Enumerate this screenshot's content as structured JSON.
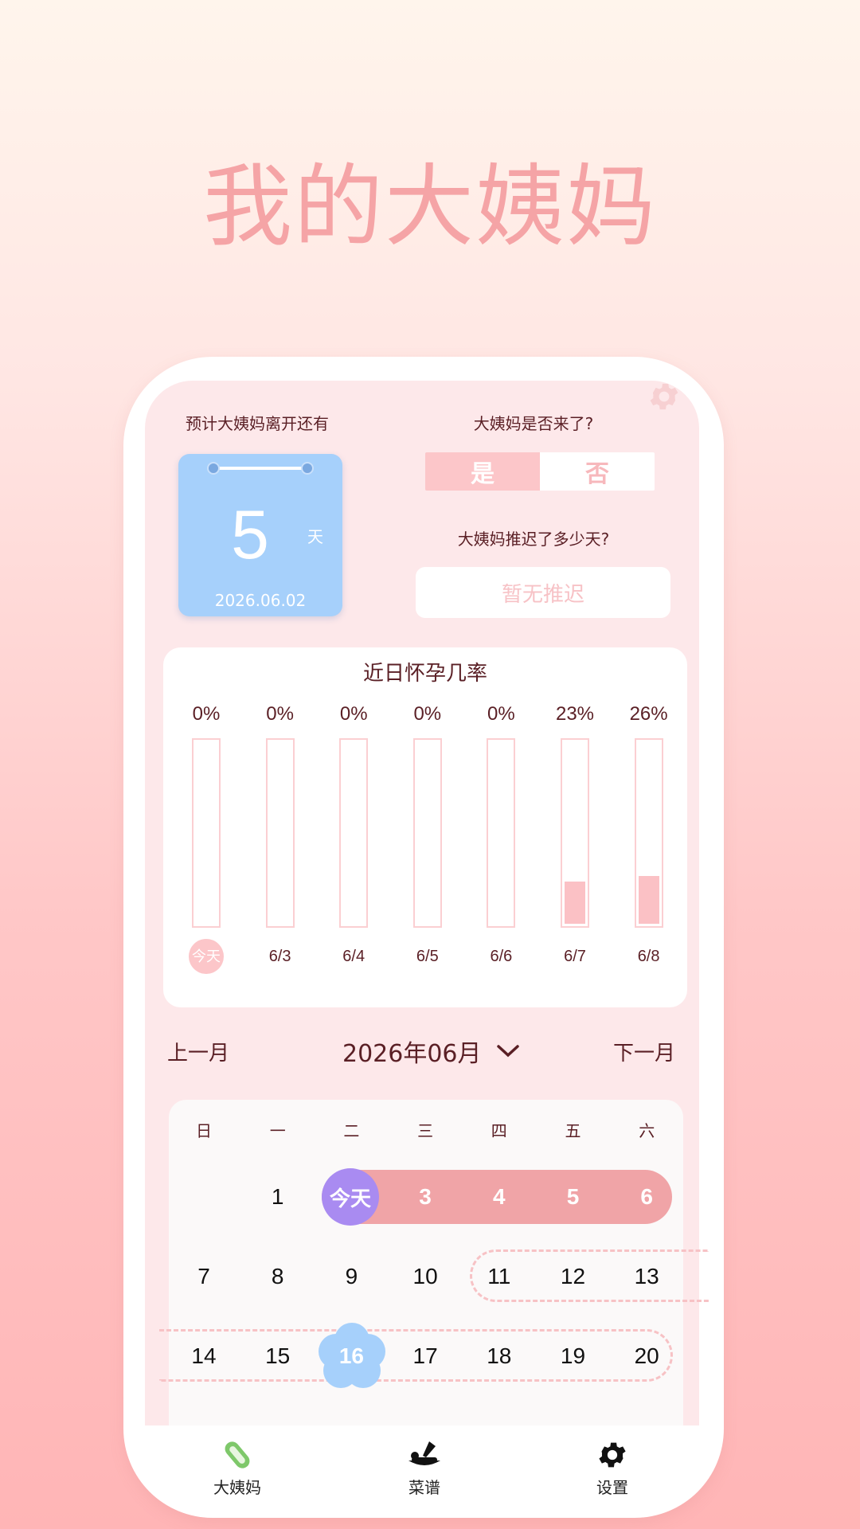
{
  "headline": "我的大姨妈",
  "summary": {
    "left_label": "预计大姨妈离开还有",
    "days_left": "5",
    "days_unit": "天",
    "end_date": "2026.06.02",
    "came_question": "大姨妈是否来了?",
    "came_yes": "是",
    "came_no": "否",
    "came_selected": "是",
    "delay_question": "大姨妈推迟了多少天?",
    "delay_value": "暂无推迟"
  },
  "pregnancy_chance": {
    "title": "近日怀孕几率",
    "columns": [
      {
        "percent": "0%",
        "level": 0,
        "day": "今天",
        "is_today": true
      },
      {
        "percent": "0%",
        "level": 0,
        "day": "6/3"
      },
      {
        "percent": "0%",
        "level": 0,
        "day": "6/4"
      },
      {
        "percent": "0%",
        "level": 0,
        "day": "6/5"
      },
      {
        "percent": "0%",
        "level": 0,
        "day": "6/6"
      },
      {
        "percent": "23%",
        "level": 0.23,
        "day": "6/7"
      },
      {
        "percent": "26%",
        "level": 0.26,
        "day": "6/8"
      }
    ]
  },
  "calendar": {
    "prev_label": "上一月",
    "next_label": "下一月",
    "month_title": "2026年06月",
    "weekdays": [
      "日",
      "一",
      "二",
      "三",
      "四",
      "五",
      "六"
    ],
    "row1": [
      "",
      "1",
      "今天",
      "3",
      "4",
      "5",
      "6"
    ],
    "row2": [
      "7",
      "8",
      "9",
      "10",
      "11",
      "12",
      "13"
    ],
    "row3": [
      "14",
      "15",
      "16",
      "17",
      "18",
      "19",
      "20"
    ],
    "colors": {
      "period": "#f0a4a7",
      "today": "#a98bf1",
      "ovulation": "#a6d0fb",
      "fertile_dash": "#f7c2c5"
    }
  },
  "tabs": [
    {
      "label": "大姨妈",
      "icon": "pad-icon"
    },
    {
      "label": "菜谱",
      "icon": "cooking-icon"
    },
    {
      "label": "设置",
      "icon": "gear-icon"
    }
  ]
}
